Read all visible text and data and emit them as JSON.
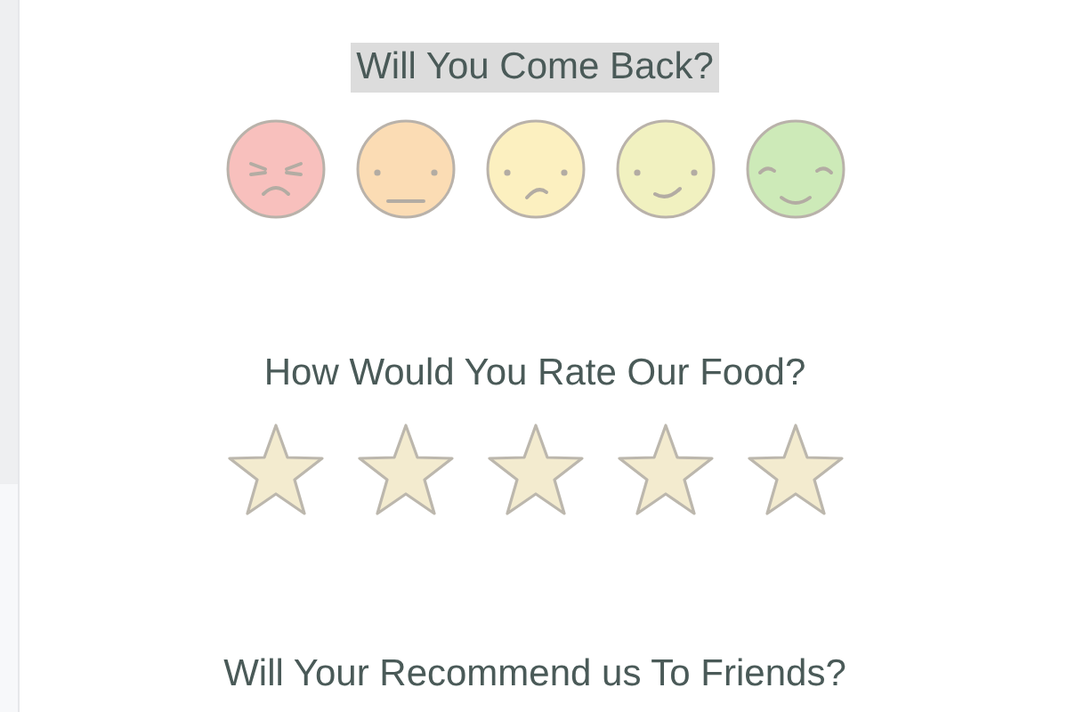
{
  "questions": [
    {
      "kind": "faces",
      "title": "Will You Come Back?",
      "highlighted": true,
      "faces": [
        {
          "kind": "angry",
          "color": "#f8c0bd",
          "selected": false
        },
        {
          "kind": "neutral",
          "color": "#fbdcb4",
          "selected": false
        },
        {
          "kind": "confused",
          "color": "#fcf0c0",
          "selected": false
        },
        {
          "kind": "smile",
          "color": "#f1f1c0",
          "selected": false
        },
        {
          "kind": "happy",
          "color": "#cdeab8",
          "selected": false
        }
      ]
    },
    {
      "kind": "stars",
      "title": "How Would You Rate Our Food?",
      "highlighted": false,
      "stars": 5
    },
    {
      "kind": "plain",
      "title": "Will Your Recommend us To Friends?",
      "highlighted": false
    }
  ]
}
